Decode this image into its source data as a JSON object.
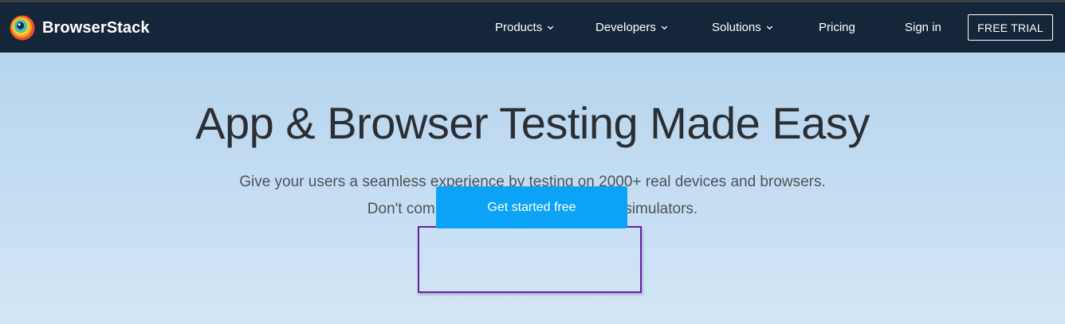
{
  "header": {
    "brand": "BrowserStack",
    "logo_icon": "browserstack-eye-logo",
    "nav": {
      "products": "Products",
      "developers": "Developers",
      "solutions": "Solutions",
      "pricing": "Pricing",
      "signin": "Sign in"
    },
    "free_trial": "FREE TRIAL"
  },
  "hero": {
    "title": "App & Browser Testing Made Easy",
    "subtitle_line1": "Give your users a seamless experience by testing on 2000+ real devices and browsers.",
    "subtitle_line2": "Don't compromise with emulators and simulators.",
    "cta": "Get started free"
  },
  "colors": {
    "header_bg": "#16263a",
    "hero_bg_top": "#b6d4ed",
    "hero_bg_bottom": "#d2e6f6",
    "cta_bg": "#0ca3f7",
    "highlight_border": "#6a1fa8"
  }
}
